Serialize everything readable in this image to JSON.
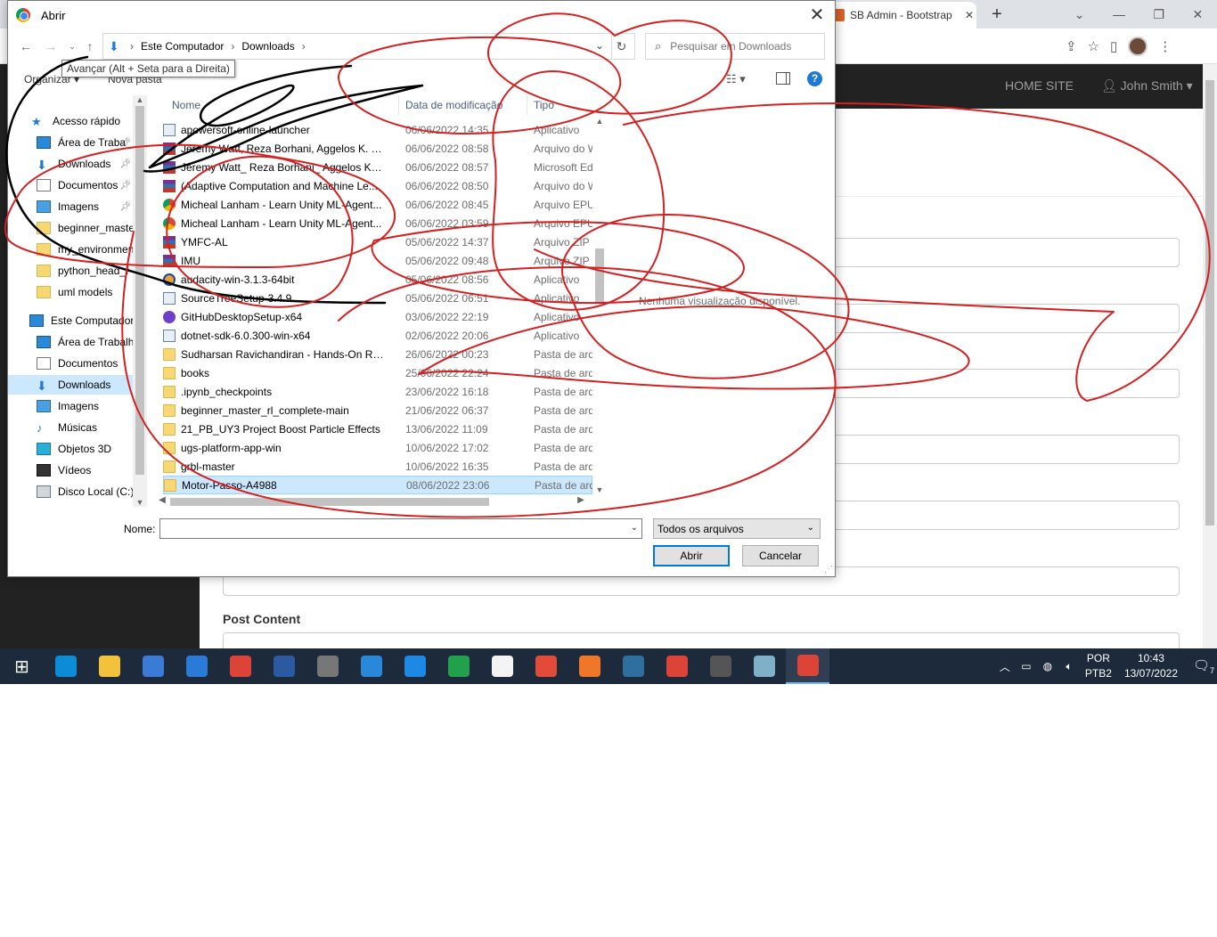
{
  "browser": {
    "tab_title": "SB Admin - Bootstrap",
    "nav_home": "HOME SITE",
    "nav_user": "John Smith"
  },
  "page": {
    "post_content_label": "Post Content"
  },
  "dialog": {
    "title": "Abrir",
    "breadcrumb": [
      "Este Computador",
      "Downloads"
    ],
    "search_placeholder": "Pesquisar em Downloads",
    "tooltip": "Avançar (Alt + Seta para a Direita)",
    "organize_label": "Organizar",
    "new_folder_label": "Nova pasta",
    "nav_pane": [
      {
        "label": "Acesso rápido",
        "icon": "star-icon",
        "pinned": false
      },
      {
        "label": "Área de Traba",
        "icon": "desktop-icon",
        "pinned": true
      },
      {
        "label": "Downloads",
        "icon": "download-icon",
        "pinned": true
      },
      {
        "label": "Documentos",
        "icon": "document-icon",
        "pinned": true
      },
      {
        "label": "Imagens",
        "icon": "picture-icon",
        "pinned": true
      },
      {
        "label": "beginner_master",
        "icon": "folder-icon",
        "pinned": false
      },
      {
        "label": "my_environmen",
        "icon": "folder-icon",
        "pinned": false
      },
      {
        "label": "python_head_f",
        "icon": "folder-icon",
        "pinned": false
      },
      {
        "label": "uml models",
        "icon": "folder-icon",
        "pinned": false
      },
      {
        "label": "Este Computador",
        "icon": "computer-icon",
        "pinned": false
      },
      {
        "label": "Área de Trabalho",
        "icon": "desktop-icon",
        "pinned": false
      },
      {
        "label": "Documentos",
        "icon": "document-icon",
        "pinned": false
      },
      {
        "label": "Downloads",
        "icon": "download-icon",
        "pinned": false,
        "selected": true
      },
      {
        "label": "Imagens",
        "icon": "picture-icon",
        "pinned": false
      },
      {
        "label": "Músicas",
        "icon": "music-icon",
        "pinned": false
      },
      {
        "label": "Objetos 3D",
        "icon": "cube-icon",
        "pinned": false
      },
      {
        "label": "Vídeos",
        "icon": "video-icon",
        "pinned": false
      },
      {
        "label": "Disco Local (C:)",
        "icon": "drive-icon",
        "pinned": false
      }
    ],
    "columns": {
      "name": "Nome",
      "date": "Data de modificação",
      "type": "Tipo"
    },
    "files": [
      {
        "name": "apowersoft-online-launcher",
        "date": "06/06/2022 14:35",
        "type": "Aplicativo",
        "icon": "exe"
      },
      {
        "name": "Jeremy Watt, Reza Borhani, Aggelos K. Ka...",
        "date": "06/06/2022 08:58",
        "type": "Arquivo do W",
        "icon": "rar"
      },
      {
        "name": "Jeremy Watt_ Reza Borhani_ Aggelos Kats...",
        "date": "06/06/2022 08:57",
        "type": "Microsoft Ed",
        "icon": "rar"
      },
      {
        "name": "(Adaptive Computation and Machine Le...",
        "date": "06/06/2022 08:50",
        "type": "Arquivo do W",
        "icon": "rar"
      },
      {
        "name": "Micheal Lanham - Learn Unity ML-Agent...",
        "date": "06/06/2022 08:45",
        "type": "Arquivo EPU",
        "icon": "chrome"
      },
      {
        "name": "Micheal Lanham - Learn Unity ML-Agent...",
        "date": "06/06/2022 03:59",
        "type": "Arquivo EPU",
        "icon": "chrome"
      },
      {
        "name": "YMFC-AL",
        "date": "05/06/2022 14:37",
        "type": "Arquivo ZIP",
        "icon": "rar"
      },
      {
        "name": "IMU",
        "date": "05/06/2022 09:48",
        "type": "Arquivo ZIP",
        "icon": "rar"
      },
      {
        "name": "audacity-win-3.1.3-64bit",
        "date": "05/06/2022 08:56",
        "type": "Aplicativo",
        "icon": "aud"
      },
      {
        "name": "SourceTreeSetup-3.4.9",
        "date": "05/06/2022 06:51",
        "type": "Aplicativo",
        "icon": "exe"
      },
      {
        "name": "GitHubDesktopSetup-x64",
        "date": "03/06/2022 22:19",
        "type": "Aplicativo",
        "icon": "gh"
      },
      {
        "name": "dotnet-sdk-6.0.300-win-x64",
        "date": "02/06/2022 20:06",
        "type": "Aplicativo",
        "icon": "exe"
      },
      {
        "name": "Sudharsan Ravichandiran - Hands-On Re...",
        "date": "26/06/2022 00:23",
        "type": "Pasta de arqu",
        "icon": "folder"
      },
      {
        "name": "books",
        "date": "25/06/2022 22:24",
        "type": "Pasta de arqu",
        "icon": "folder"
      },
      {
        "name": ".ipynb_checkpoints",
        "date": "23/06/2022 16:18",
        "type": "Pasta de arqu",
        "icon": "folder"
      },
      {
        "name": "beginner_master_rl_complete-main",
        "date": "21/06/2022 06:37",
        "type": "Pasta de arqu",
        "icon": "folder"
      },
      {
        "name": "21_PB_UY3 Project Boost Particle Effects",
        "date": "13/06/2022 11:09",
        "type": "Pasta de arqu",
        "icon": "folder"
      },
      {
        "name": "ugs-platform-app-win",
        "date": "10/06/2022 17:02",
        "type": "Pasta de arqu",
        "icon": "folder"
      },
      {
        "name": "grbl-master",
        "date": "10/06/2022 16:35",
        "type": "Pasta de arqu",
        "icon": "folder"
      },
      {
        "name": "Motor-Passo-A4988",
        "date": "08/06/2022 23:06",
        "type": "Pasta de arqu",
        "icon": "folder",
        "selected": true
      }
    ],
    "preview_text": "Nenhuma visualização disponível.",
    "filename_label": "Nome:",
    "filename_value": "",
    "file_type": "Todos os arquivos",
    "open_button": "Abrir",
    "cancel_button": "Cancelar"
  },
  "taskbar": {
    "apps": [
      {
        "icon": "windows-start-icon",
        "color": "#1c2a3b"
      },
      {
        "icon": "edge-icon",
        "color": "#0c8bd6"
      },
      {
        "icon": "file-explorer-icon",
        "color": "#f3c13a"
      },
      {
        "icon": "store-icon",
        "color": "#3a7bd5"
      },
      {
        "icon": "mail-icon",
        "color": "#2a7bd8"
      },
      {
        "icon": "chrome-profile-icon",
        "color": "#db4437"
      },
      {
        "icon": "powershell-icon",
        "color": "#2c5aa0"
      },
      {
        "icon": "unity-icon",
        "color": "#777777"
      },
      {
        "icon": "app-blue-icon",
        "color": "#2a88d8"
      },
      {
        "icon": "vscode-icon",
        "color": "#1e88e5"
      },
      {
        "icon": "circle-app-icon",
        "color": "#22a04b"
      },
      {
        "icon": "notepad-icon",
        "color": "#f4f4f4"
      },
      {
        "icon": "app-red-icon",
        "color": "#e24a3a"
      },
      {
        "icon": "xampp-icon",
        "color": "#f0762a"
      },
      {
        "icon": "mysql-workbench-icon",
        "color": "#2f6f9f"
      },
      {
        "icon": "chrome-profile2-icon",
        "color": "#db4437"
      },
      {
        "icon": "settings-icon",
        "color": "#555555"
      },
      {
        "icon": "app-teal-icon",
        "color": "#7fb0c8"
      },
      {
        "icon": "chrome-icon",
        "color": "#db4437",
        "active": true
      }
    ],
    "lang_top": "POR",
    "lang_bottom": "PTB2",
    "time": "10:43",
    "date": "13/07/2022",
    "notifications": "7"
  },
  "colors": {
    "annotation_red": "#d42020",
    "annotation_black": "#000000",
    "selection": "#cce8ff",
    "accent": "#0078d7"
  }
}
